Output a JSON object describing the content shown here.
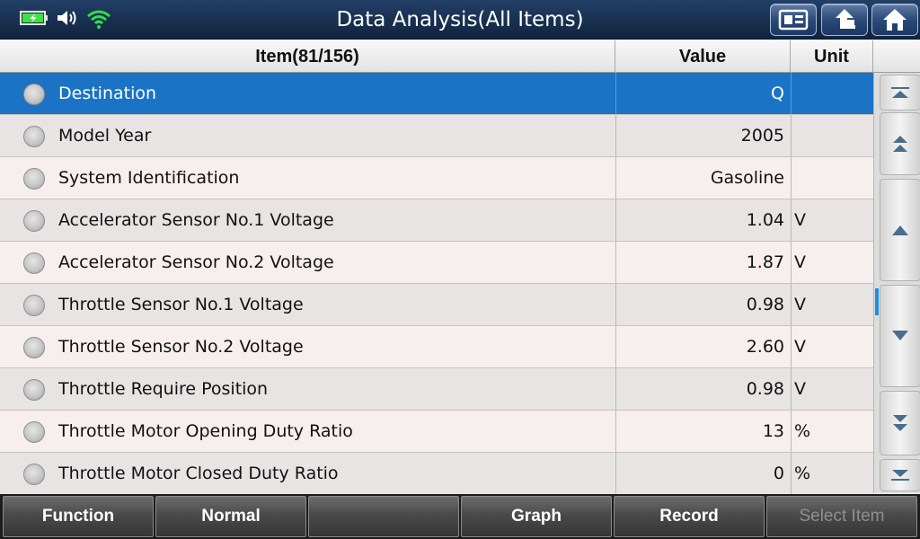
{
  "header": {
    "title": "Data Analysis(All Items)",
    "colors": {
      "bar": "#18304f",
      "battery": "#3fe03f",
      "wifi": "#2ee04a"
    },
    "icons": [
      "battery-icon",
      "speaker-icon",
      "wifi-icon",
      "report-icon",
      "back-arrow-icon",
      "home-icon"
    ]
  },
  "table": {
    "columns": {
      "item": "Item(81/156)",
      "value": "Value",
      "unit": "Unit"
    },
    "selected_color": "#1a73c4",
    "rows": [
      {
        "name": "Destination",
        "value": "Q",
        "unit": ""
      },
      {
        "name": "Model Year",
        "value": "2005",
        "unit": ""
      },
      {
        "name": "System Identification",
        "value": "Gasoline",
        "unit": ""
      },
      {
        "name": "Accelerator Sensor No.1 Voltage",
        "value": "1.04",
        "unit": "V"
      },
      {
        "name": "Accelerator Sensor No.2 Voltage",
        "value": "1.87",
        "unit": "V"
      },
      {
        "name": "Throttle Sensor No.1 Voltage",
        "value": "0.98",
        "unit": "V"
      },
      {
        "name": "Throttle Sensor No.2 Voltage",
        "value": "2.60",
        "unit": "V"
      },
      {
        "name": "Throttle Require Position",
        "value": "0.98",
        "unit": "V"
      },
      {
        "name": "Throttle Motor Opening Duty Ratio",
        "value": "13",
        "unit": "%"
      },
      {
        "name": "Throttle Motor Closed Duty Ratio",
        "value": "0",
        "unit": "%"
      }
    ]
  },
  "scroll": {
    "icons": [
      "scroll-top-icon",
      "page-up-icon",
      "scroll-up-icon",
      "scroll-down-icon",
      "page-down-icon",
      "scroll-bottom-icon"
    ]
  },
  "toolbar": {
    "function_label": "Function",
    "normal_label": "Normal",
    "empty_label": "",
    "graph_label": "Graph",
    "record_label": "Record",
    "select_item_label": "Select Item"
  }
}
